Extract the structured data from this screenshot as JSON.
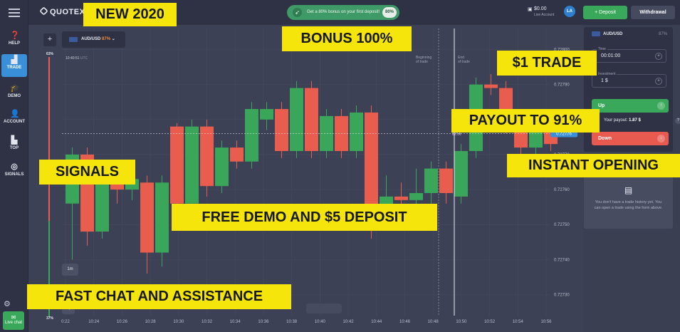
{
  "sidebar": {
    "items": [
      {
        "label": "HELP",
        "icon": "help-icon"
      },
      {
        "label": "TRADE",
        "icon": "chart-icon"
      },
      {
        "label": "DEMO",
        "icon": "graduation-cap-icon"
      },
      {
        "label": "ACCOUNT",
        "icon": "user-icon"
      },
      {
        "label": "TOP",
        "icon": "podium-icon"
      },
      {
        "label": "SIGNALS",
        "icon": "signal-icon"
      }
    ],
    "live_chat": "Live chat"
  },
  "header": {
    "logo": "QUOTEX",
    "promo_text": "Get a 80% bonus on your first deposit!",
    "promo_badge": "80%",
    "balance": "$0.00",
    "account_label": "Live Account",
    "avatar": "LA",
    "deposit": "Deposit",
    "withdrawal": "Withdrawal"
  },
  "chart": {
    "asset": "AUD/USD",
    "asset_payout": "87%",
    "time": "10:40:51",
    "time_zone": "UTC",
    "pct_top": "63%",
    "pct_bottom": "37%",
    "timeframe": "1m",
    "marker_beginning": [
      "Beginning",
      "of trade"
    ],
    "marker_end": [
      "End",
      "of trade"
    ],
    "current_price": "0.72776",
    "current_time": "00:56",
    "colors": {
      "up": "#3aa65a",
      "down": "#e85d4e",
      "background": "#3c4155",
      "accent": "#3a8fd9"
    }
  },
  "chart_data": {
    "type": "candlestick",
    "y_ticks": [
      "0.72800",
      "0.72790",
      "0.72780",
      "0.72770",
      "0.72760",
      "0.72750",
      "0.72740",
      "0.72730"
    ],
    "x_ticks": [
      "0:22",
      "10:24",
      "10:26",
      "10:28",
      "10:30",
      "10:32",
      "10:34",
      "10:36",
      "10:38",
      "10:40",
      "10:42",
      "10:44",
      "10:46",
      "10:48",
      "10:50",
      "10:52",
      "10:54",
      "10:56"
    ],
    "ylim": [
      0.72724,
      0.72806
    ],
    "candles": [
      {
        "open": 0.72756,
        "close": 0.7277,
        "high": 0.72772,
        "low": 0.7274,
        "dir": "up"
      },
      {
        "open": 0.7277,
        "close": 0.72748,
        "high": 0.72772,
        "low": 0.72744,
        "dir": "down"
      },
      {
        "open": 0.72748,
        "close": 0.72766,
        "high": 0.72768,
        "low": 0.72746,
        "dir": "up"
      },
      {
        "open": 0.72766,
        "close": 0.7276,
        "high": 0.72768,
        "low": 0.72756,
        "dir": "down"
      },
      {
        "open": 0.7276,
        "close": 0.72763,
        "high": 0.72765,
        "low": 0.72757,
        "dir": "up"
      },
      {
        "open": 0.72762,
        "close": 0.72742,
        "high": 0.72764,
        "low": 0.72736,
        "dir": "down"
      },
      {
        "open": 0.72742,
        "close": 0.72762,
        "high": 0.72764,
        "low": 0.72738,
        "dir": "up"
      },
      {
        "open": 0.72778,
        "close": 0.72756,
        "high": 0.72779,
        "low": 0.72754,
        "dir": "down"
      },
      {
        "open": 0.72756,
        "close": 0.72778,
        "high": 0.7278,
        "low": 0.72754,
        "dir": "up"
      },
      {
        "open": 0.72778,
        "close": 0.72761,
        "high": 0.7278,
        "low": 0.72758,
        "dir": "down"
      },
      {
        "open": 0.72761,
        "close": 0.72772,
        "high": 0.72774,
        "low": 0.72759,
        "dir": "up"
      },
      {
        "open": 0.72772,
        "close": 0.72768,
        "high": 0.72774,
        "low": 0.72766,
        "dir": "down"
      },
      {
        "open": 0.72768,
        "close": 0.72783,
        "high": 0.72785,
        "low": 0.72766,
        "dir": "up"
      },
      {
        "open": 0.7278,
        "close": 0.72783,
        "high": 0.72785,
        "low": 0.72777,
        "dir": "up"
      },
      {
        "open": 0.72783,
        "close": 0.72771,
        "high": 0.72785,
        "low": 0.72769,
        "dir": "down"
      },
      {
        "open": 0.72771,
        "close": 0.72789,
        "high": 0.72791,
        "low": 0.72769,
        "dir": "up"
      },
      {
        "open": 0.72789,
        "close": 0.72771,
        "high": 0.72791,
        "low": 0.72769,
        "dir": "down"
      },
      {
        "open": 0.72771,
        "close": 0.72781,
        "high": 0.72783,
        "low": 0.72769,
        "dir": "up"
      },
      {
        "open": 0.72781,
        "close": 0.72771,
        "high": 0.72783,
        "low": 0.72769,
        "dir": "down"
      },
      {
        "open": 0.72771,
        "close": 0.72782,
        "high": 0.72784,
        "low": 0.72769,
        "dir": "up"
      },
      {
        "open": 0.72782,
        "close": 0.72754,
        "high": 0.72784,
        "low": 0.72746,
        "dir": "down"
      },
      {
        "open": 0.72754,
        "close": 0.72758,
        "high": 0.72764,
        "low": 0.72752,
        "dir": "up"
      },
      {
        "open": 0.72758,
        "close": 0.72757,
        "high": 0.72762,
        "low": 0.72754,
        "dir": "down"
      },
      {
        "open": 0.72757,
        "close": 0.72759,
        "high": 0.72766,
        "low": 0.72755,
        "dir": "up"
      },
      {
        "open": 0.72759,
        "close": 0.72766,
        "high": 0.72768,
        "low": 0.72756,
        "dir": "up"
      },
      {
        "open": 0.72766,
        "close": 0.72759,
        "high": 0.72768,
        "low": 0.72756,
        "dir": "down"
      },
      {
        "open": 0.72758,
        "close": 0.72771,
        "high": 0.72773,
        "low": 0.72756,
        "dir": "up"
      },
      {
        "open": 0.72771,
        "close": 0.7279,
        "high": 0.72792,
        "low": 0.72769,
        "dir": "up"
      },
      {
        "open": 0.7279,
        "close": 0.72789,
        "high": 0.72793,
        "low": 0.72787,
        "dir": "down"
      },
      {
        "open": 0.72789,
        "close": 0.72778,
        "high": 0.72791,
        "low": 0.72776,
        "dir": "down"
      },
      {
        "open": 0.72778,
        "close": 0.72772,
        "high": 0.7278,
        "low": 0.7277,
        "dir": "down"
      },
      {
        "open": 0.72772,
        "close": 0.72777,
        "high": 0.72778,
        "low": 0.72769,
        "dir": "up"
      },
      {
        "open": 0.72777,
        "close": 0.72773,
        "high": 0.72778,
        "low": 0.72771,
        "dir": "down"
      }
    ]
  },
  "trade_panel": {
    "asset": "AUD/USD",
    "asset_payout": "87%",
    "time_label": "Time",
    "time_value": "00:01:00",
    "investment_label": "Investment",
    "investment_value": "1 $",
    "up": "Up",
    "down": "Down",
    "payout_label": "Your payout:",
    "payout_value": "1.87 $",
    "history_empty": "You don't have a trade history yet. You can open a trade using the form above."
  },
  "overlays": {
    "new": "NEW 2020",
    "bonus": "BONUS 100%",
    "one_trade": "$1 TRADE",
    "payout": "PAYOUT TO 91%",
    "instant": "INSTANT OPENING",
    "signals": "SIGNALS",
    "demo": "FREE DEMO AND $5 DEPOSIT",
    "chat": "FAST CHAT AND ASSISTANCE"
  }
}
